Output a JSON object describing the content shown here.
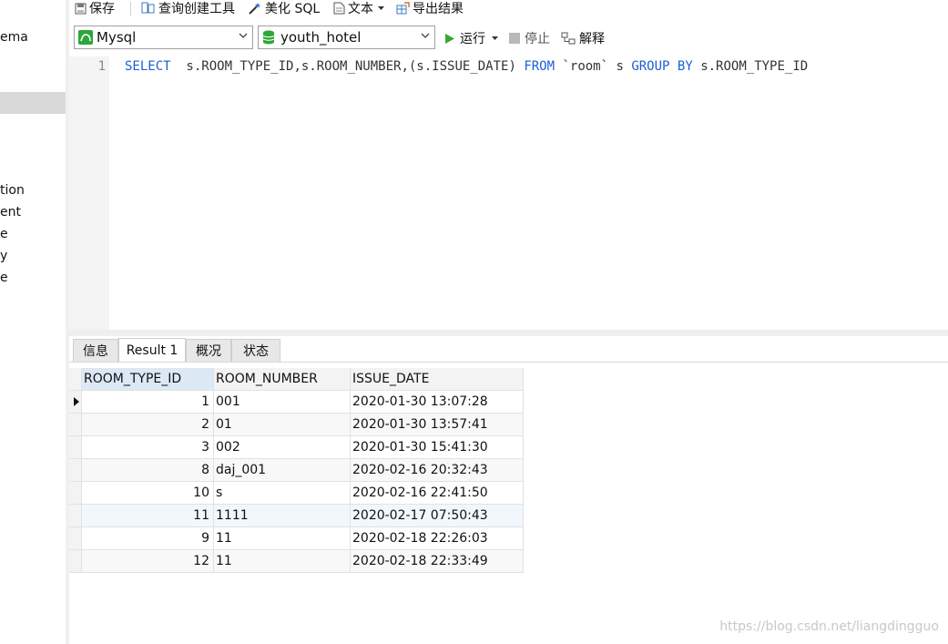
{
  "sidebar": {
    "items": [
      "ema",
      "tion",
      "ent",
      "e",
      "y",
      "e"
    ]
  },
  "toolbar": {
    "save": "保存",
    "query_builder": "查询创建工具",
    "beautify": "美化 SQL",
    "text": "文本",
    "export": "导出结果"
  },
  "connection": {
    "selected": "Mysql"
  },
  "database": {
    "selected": "youth_hotel"
  },
  "actions": {
    "run": "运行",
    "stop": "停止",
    "explain": "解释"
  },
  "editor": {
    "line_number": "1",
    "tokens": [
      {
        "text": "SELECT",
        "kw": true
      },
      {
        "text": "  s.ROOM_TYPE_ID,s.ROOM_NUMBER,(s.ISSUE_DATE) ",
        "kw": false
      },
      {
        "text": "FROM",
        "kw": true
      },
      {
        "text": " `room` s ",
        "kw": false
      },
      {
        "text": "GROUP BY",
        "kw": true
      },
      {
        "text": " s.ROOM_TYPE_ID",
        "kw": false
      }
    ]
  },
  "tabs": [
    "信息",
    "Result 1",
    "概况",
    "状态"
  ],
  "result": {
    "columns": [
      "ROOM_TYPE_ID",
      "ROOM_NUMBER",
      "ISSUE_DATE"
    ],
    "rows": [
      [
        "1",
        "001",
        "2020-01-30 13:07:28"
      ],
      [
        "2",
        "01",
        "2020-01-30 13:57:41"
      ],
      [
        "3",
        "002",
        "2020-01-30 15:41:30"
      ],
      [
        "8",
        "daj_001",
        "2020-02-16 20:32:43"
      ],
      [
        "10",
        "s",
        "2020-02-16 22:41:50"
      ],
      [
        "11",
        "1111",
        "2020-02-17 07:50:43"
      ],
      [
        "9",
        "11",
        "2020-02-18 22:26:03"
      ],
      [
        "12",
        "11",
        "2020-02-18 22:33:49"
      ]
    ]
  },
  "watermark": "https://blog.csdn.net/liangdingguo",
  "colors": {
    "keyword": "#1c5fd6",
    "run_green": "#3aa635",
    "db_green": "#2aa83a"
  }
}
